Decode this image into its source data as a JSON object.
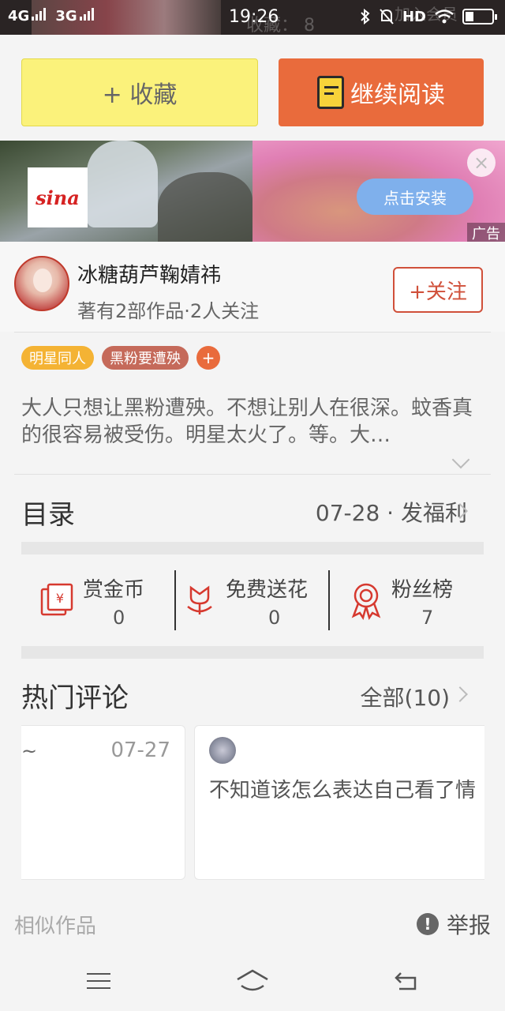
{
  "status_bar": {
    "network1": "4G",
    "network2": "3G",
    "time": "19:26",
    "hd": "HD",
    "ghost_text": "收藏： 8",
    "ghost_text2": "加入会员"
  },
  "actions": {
    "favorite_label": "+ 收藏",
    "continue_label": "继续阅读"
  },
  "ad": {
    "brand": "sina",
    "install_label": "点击安装",
    "ad_tag": "广告",
    "close": "×"
  },
  "author": {
    "name": "冰糖葫芦鞠婧祎",
    "meta": "著有2部作品·2人关注",
    "follow_label": "+关注"
  },
  "tags": {
    "items": [
      "明星同人",
      "黑粉要遭殃"
    ],
    "add": "+"
  },
  "description": "大人只想让黑粉遭殃。不想让别人在很深。蚊香真的很容易被受伤。明星太火了。等。大…",
  "catalog": {
    "title": "目录",
    "latest": "07-28 · 发福利"
  },
  "stats": {
    "coins_label": "赏金币",
    "coins_value": "0",
    "flowers_label": "免费送花",
    "flowers_value": "0",
    "fans_label": "粉丝榜",
    "fans_value": "7"
  },
  "comments": {
    "title": "热门评论",
    "all_label": "全部(10)",
    "card1_snippet": "~",
    "card1_date": "07-27",
    "card2_text": "不知道该怎么表达自己看了情"
  },
  "footer": {
    "similar_label": "相似作品",
    "report_label": "举报"
  },
  "colors": {
    "favorite_bg": "#fbf27b",
    "continue_bg": "#e96b3c",
    "accent_red": "#d0503a",
    "tag1": "#f4b334",
    "tag2": "#c56a5a"
  }
}
